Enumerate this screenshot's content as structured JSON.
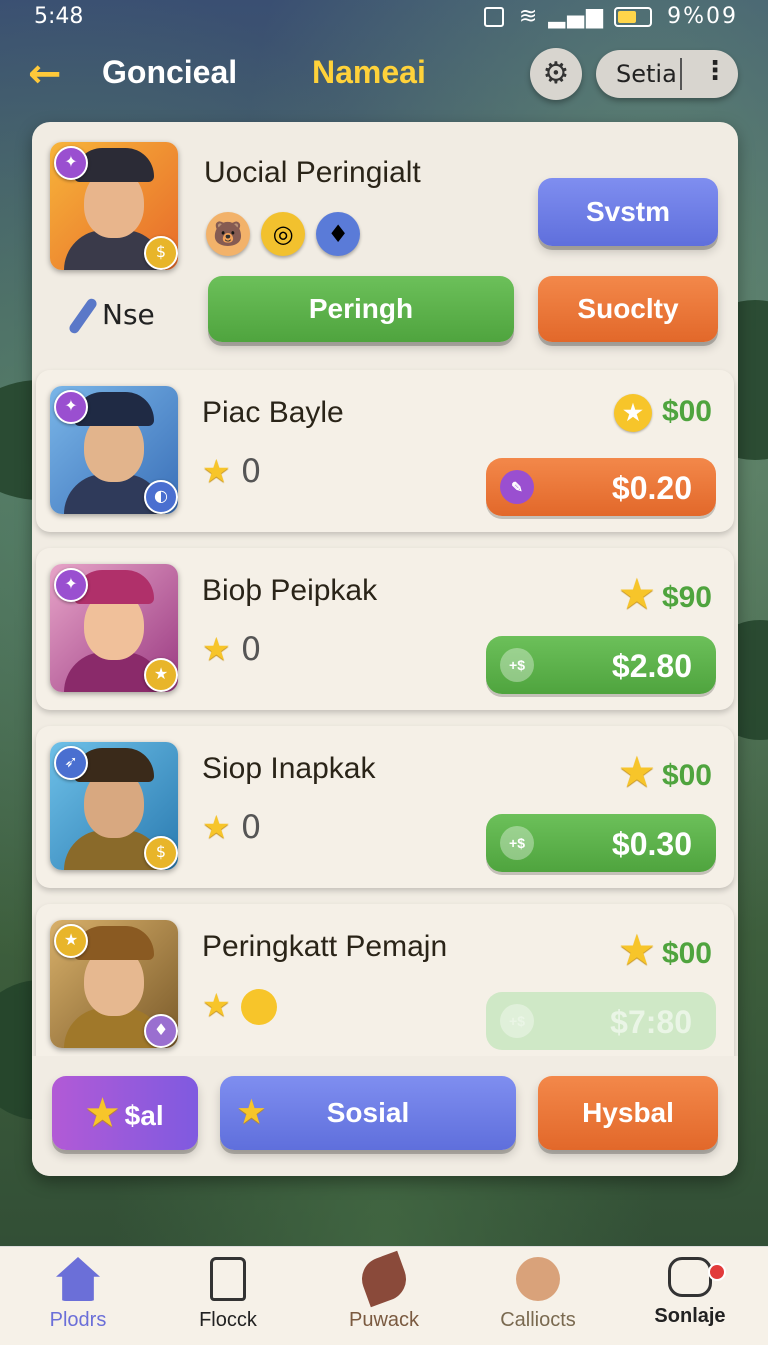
{
  "status_bar": {
    "time": "5:48",
    "right": "9%09"
  },
  "header": {
    "back_icon": "arrow-left-icon",
    "title_left": "Goncieal",
    "title_right": "Nameai",
    "gear_icon": "gear-icon",
    "settings_label": "Setia",
    "more_icon": "vertical-dots-icon"
  },
  "profile": {
    "name": "Uocial Peringialt",
    "secondary_label": "Nse",
    "buttons": {
      "top": "Svstm",
      "middle": "Peringh",
      "right": "Suoclty"
    }
  },
  "rows": [
    {
      "name": "Piac Bayle",
      "stars": "0",
      "reward": "$00",
      "price": "$0.20",
      "button_color": "orange"
    },
    {
      "name": "Bioþ Peipkak",
      "stars": "0",
      "reward": "$90",
      "price": "$2.80",
      "button_icon_text": "+$",
      "button_color": "green"
    },
    {
      "name": "Siop Inapkak",
      "stars": "0",
      "reward": "$00",
      "price": "$0.30",
      "button_icon_text": "+$",
      "button_color": "green"
    },
    {
      "name": "Peringkatt Pemajn",
      "reward": "$00",
      "price": "$7:80",
      "button_icon_text": "+$",
      "button_color": "faded"
    }
  ],
  "footer_buttons": {
    "left": "$al",
    "center": "Sosial",
    "right": "Hysbal"
  },
  "bottom_nav": [
    {
      "label": "Plodrs",
      "icon": "home-icon",
      "color": "#6b6fd8"
    },
    {
      "label": "Flocck",
      "icon": "bag-icon",
      "color": "#222222"
    },
    {
      "label": "Puwack",
      "icon": "leaf-icon",
      "color": "#7a5a40"
    },
    {
      "label": "Calliocts",
      "icon": "bunny-icon",
      "color": "#7a6a50"
    },
    {
      "label": "Sonlaje",
      "icon": "chat-icon",
      "color": "#222222"
    }
  ],
  "colors": {
    "accent_yellow": "#ffd23a",
    "green": "#4fa43e",
    "orange": "#e2682a",
    "blue": "#5f6fdc"
  }
}
